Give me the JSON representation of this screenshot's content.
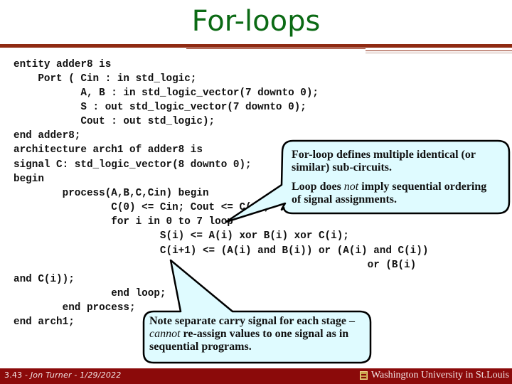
{
  "slide": {
    "title": "For-loops",
    "code_lines": [
      "entity adder8 is",
      "    Port ( Cin : in std_logic;",
      "           A, B : in std_logic_vector(7 downto 0);",
      "           S : out std_logic_vector(7 downto 0);",
      "           Cout : out std_logic);",
      "end adder8;",
      "architecture arch1 of adder8 is",
      "signal C: std_logic_vector(8 downto 0);",
      "begin",
      "        process(A,B,C,Cin) begin",
      "                C(0) <= Cin; Cout <= C(8);",
      "                for i in 0 to 7 loop",
      "                        S(i) <= A(i) xor B(i) xor C(i);",
      "                        C(i+1) <= (A(i) and B(i)) or (A(i) and C(i))",
      "                                                          or (B(i)",
      "and C(i));",
      "                end loop;",
      "        end process;",
      "end arch1;"
    ],
    "callout_top": {
      "line1": "For-loop defines multiple identical (or",
      "line2": "similar) sub-circuits.",
      "line3_pre": "Loop does ",
      "line3_em": "not",
      "line3_post": " imply sequential ordering",
      "line4": "of signal assignments."
    },
    "callout_bottom": {
      "line1": "Note separate carry signal for each stage –",
      "line2_em": "cannot",
      "line2_post": " re-assign values to one signal as in",
      "line3": "sequential programs."
    },
    "callout_fill": "#dffbff",
    "footer": {
      "left_num": "3.43",
      "left_text": " - Jon Turner - 1/29/2022",
      "right_text": "Washington University in St.Louis",
      "bg_color": "#8b0a0a"
    },
    "title_color": "#0b6a14",
    "rule_color": "#8f2a12"
  }
}
